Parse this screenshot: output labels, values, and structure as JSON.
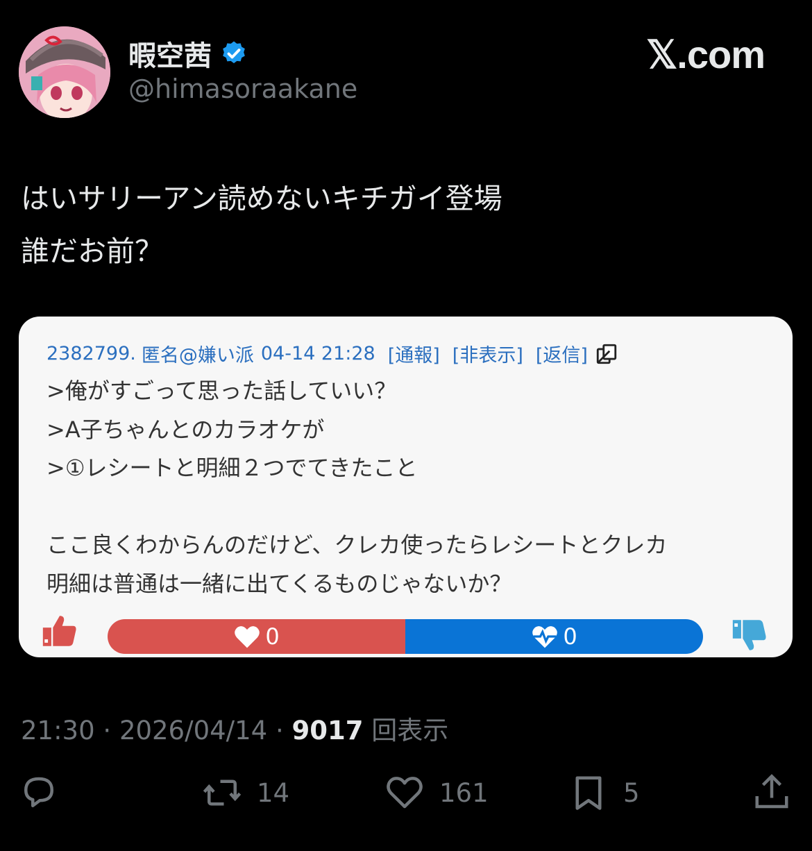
{
  "author": {
    "display_name": "暇空茜",
    "handle": "@himasoraakane",
    "verified": true,
    "avatar": "anime-girl-avatar"
  },
  "site": {
    "logo_text": "𝕏.com"
  },
  "tweet": {
    "text": "はいサリーアン読めないキチガイ登場\n誰だお前？"
  },
  "embedded_post": {
    "number": "2382799.",
    "author": "匿名@嫌い派",
    "datetime": "04-14 21:28",
    "report_link": "[通報]",
    "hide_link": "[非表示]",
    "reply_link": "[返信]",
    "body": ">俺がすごって思った話していい？\n>A子ちゃんとのカラオケが\n>①レシートと明細２つでてきたこと\n\nここ良くわからんのだけど、クレカ使ったらレシートとクレカ\n明細は普通は一緒に出てくるものじゃないか？",
    "likes": "0",
    "dislikes": "0",
    "like_share": 0.5,
    "colors": {
      "like": "#d9534f",
      "dislike": "#0a74d6",
      "meta": "#2b6fbf"
    }
  },
  "meta": {
    "time": "21:30",
    "separator": "·",
    "date": "2026/04/14",
    "views_count": "9017",
    "views_label": "回表示"
  },
  "actions": {
    "reply": {
      "icon": "reply-icon"
    },
    "retweet": {
      "icon": "retweet-icon",
      "count": "14"
    },
    "like": {
      "icon": "heart-icon",
      "count": "161"
    },
    "bookmark": {
      "icon": "bookmark-icon",
      "count": "5"
    },
    "share": {
      "icon": "share-icon"
    }
  }
}
